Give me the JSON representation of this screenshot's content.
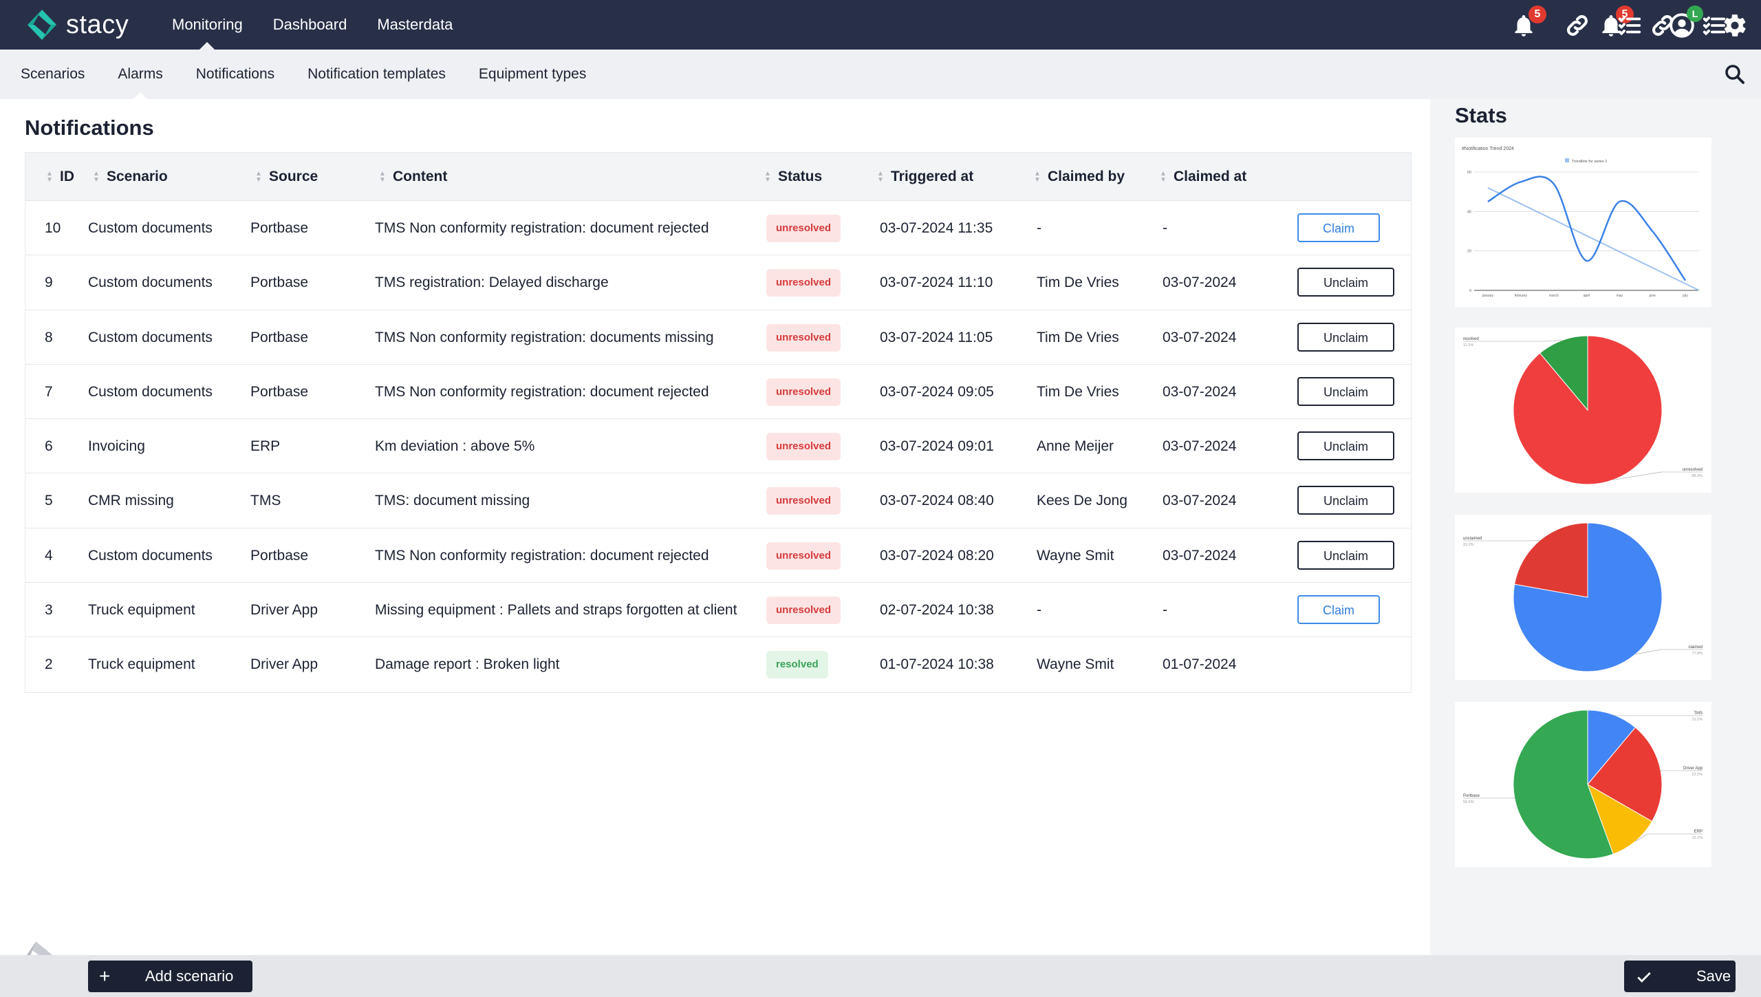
{
  "app": {
    "name": "stacy"
  },
  "nav": {
    "main": [
      "Monitoring",
      "Dashboard",
      "Masterdata"
    ],
    "active_main": "Monitoring",
    "sub": [
      "Scenarios",
      "Alarms",
      "Notifications",
      "Notification templates",
      "Equipment types"
    ],
    "active_sub": "Alarms"
  },
  "header_icons": {
    "notifications_badge": "5",
    "user_badge": "L"
  },
  "page": {
    "title": "Notifications"
  },
  "table": {
    "columns": {
      "id": "ID",
      "scenario": "Scenario",
      "source": "Source",
      "content": "Content",
      "status": "Status",
      "triggered": "Triggered at",
      "claimed_by": "Claimed by",
      "claimed_at": "Claimed at"
    },
    "rows": [
      {
        "id": "10",
        "scenario": "Custom documents",
        "source": "Portbase",
        "content": "TMS Non conformity registration: document rejected",
        "status": "unresolved",
        "triggered": "03-07-2024 11:35",
        "claimed_by": "-",
        "claimed_at": "-",
        "action": "Claim"
      },
      {
        "id": "9",
        "scenario": "Custom documents",
        "source": "Portbase",
        "content": "TMS registration: Delayed discharge",
        "status": "unresolved",
        "triggered": "03-07-2024 11:10",
        "claimed_by": "Tim De Vries",
        "claimed_at": "03-07-2024",
        "action": "Unclaim"
      },
      {
        "id": "8",
        "scenario": "Custom documents",
        "source": "Portbase",
        "content": "TMS Non conformity registration: documents missing",
        "status": "unresolved",
        "triggered": "03-07-2024 11:05",
        "claimed_by": "Tim De Vries",
        "claimed_at": "03-07-2024",
        "action": "Unclaim"
      },
      {
        "id": "7",
        "scenario": "Custom documents",
        "source": "Portbase",
        "content": "TMS Non conformity registration: document rejected",
        "status": "unresolved",
        "triggered": "03-07-2024 09:05",
        "claimed_by": "Tim De Vries",
        "claimed_at": "03-07-2024",
        "action": "Unclaim"
      },
      {
        "id": "6",
        "scenario": "Invoicing",
        "source": "ERP",
        "content": "Km deviation : above 5%",
        "status": "unresolved",
        "triggered": "03-07-2024 09:01",
        "claimed_by": "Anne Meijer",
        "claimed_at": "03-07-2024",
        "action": "Unclaim"
      },
      {
        "id": "5",
        "scenario": "CMR missing",
        "source": "TMS",
        "content": "TMS: document missing",
        "status": "unresolved",
        "triggered": "03-07-2024 08:40",
        "claimed_by": "Kees De Jong",
        "claimed_at": "03-07-2024",
        "action": "Unclaim"
      },
      {
        "id": "4",
        "scenario": "Custom documents",
        "source": "Portbase",
        "content": "TMS Non conformity registration: document rejected",
        "status": "unresolved",
        "triggered": "03-07-2024 08:20",
        "claimed_by": "Wayne Smit",
        "claimed_at": "03-07-2024",
        "action": "Unclaim"
      },
      {
        "id": "3",
        "scenario": "Truck equipment",
        "source": "Driver App",
        "content": "Missing equipment : Pallets and straps forgotten at client",
        "status": "unresolved",
        "triggered": "02-07-2024 10:38",
        "claimed_by": "-",
        "claimed_at": "-",
        "action": "Claim"
      },
      {
        "id": "2",
        "scenario": "Truck equipment",
        "source": "Driver App",
        "content": "Damage report : Broken light",
        "status": "resolved",
        "triggered": "01-07-2024 10:38",
        "claimed_by": "Wayne Smit",
        "claimed_at": "01-07-2024",
        "action": ""
      }
    ]
  },
  "stats": {
    "title": "Stats"
  },
  "chart_data": [
    {
      "type": "line",
      "title": "#Notification Trend 2024",
      "categories": [
        "january",
        "february",
        "march",
        "april",
        "may",
        "june",
        "july"
      ],
      "series": [
        {
          "name": "Trendline for series 1",
          "values": [
            52,
            60,
            41,
            53,
            51,
            22,
            0
          ],
          "color": "#9ec2f0"
        },
        {
          "values": [
            45,
            55,
            54,
            15,
            45,
            30,
            5
          ],
          "color": "#3b82e6"
        }
      ],
      "ylim": [
        0,
        60
      ],
      "yticks": [
        "0",
        "20",
        "40",
        "60"
      ],
      "legend": "top"
    },
    {
      "type": "pie",
      "slices": [
        {
          "label": "unresolved",
          "value": 88.9,
          "pct": "88.9%",
          "color": "#f03e3e"
        },
        {
          "label": "resolved",
          "value": 11.1,
          "pct": "11.1%",
          "color": "#2f9e44"
        }
      ]
    },
    {
      "type": "pie",
      "slices": [
        {
          "label": "claimed",
          "value": 77.8,
          "pct": "77.8%",
          "color": "#4285f4"
        },
        {
          "label": "unclaimed",
          "value": 22.2,
          "pct": "22.2%",
          "color": "#e03a34"
        }
      ]
    },
    {
      "type": "pie",
      "slices": [
        {
          "label": "TMS",
          "value": 11.1,
          "pct": "11.1%",
          "color": "#4285f4"
        },
        {
          "label": "Driver App",
          "value": 22.2,
          "pct": "22.2%",
          "color": "#ea3a34"
        },
        {
          "label": "ERP",
          "value": 11.1,
          "pct": "11.1%",
          "color": "#fbbc05"
        },
        {
          "label": "Portbase",
          "value": 55.6,
          "pct": "55.6%",
          "color": "#34a853"
        }
      ]
    }
  ],
  "footer": {
    "add_label": "Add scenario",
    "save_label": "Save"
  }
}
